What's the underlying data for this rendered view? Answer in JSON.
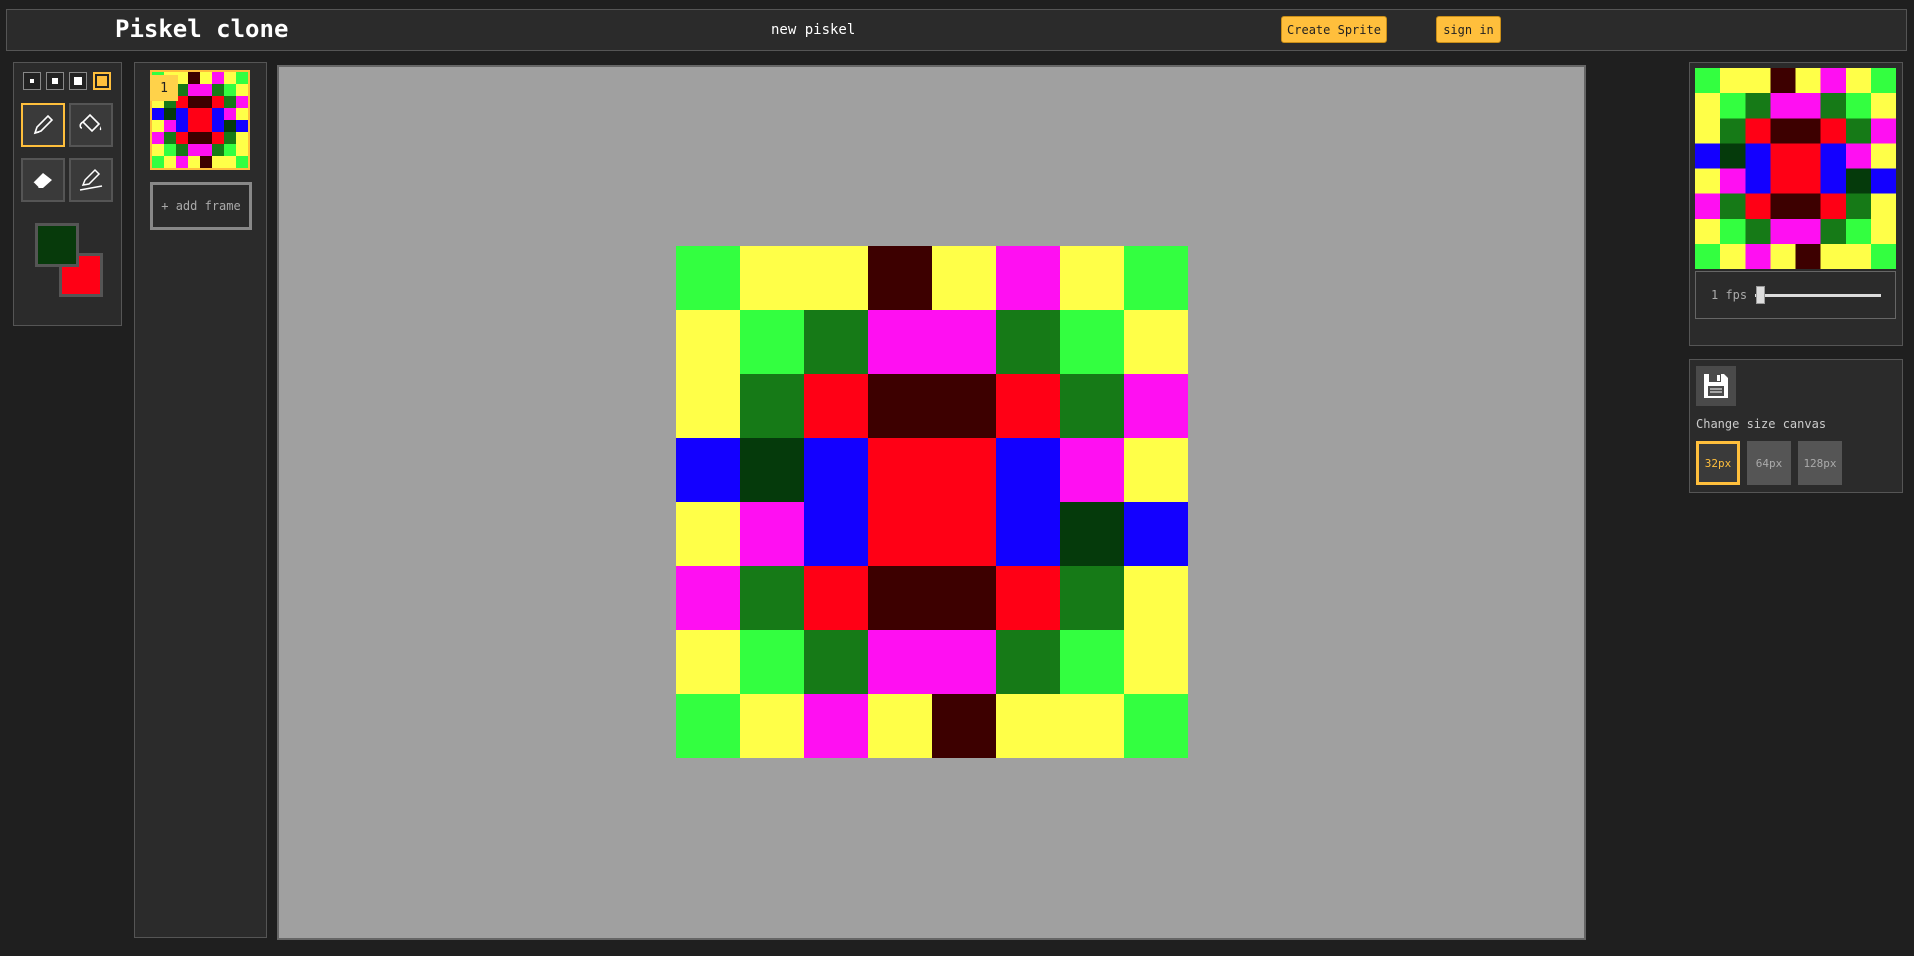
{
  "header": {
    "app_title": "Piskel clone",
    "doc_title": "new piskel",
    "create_label": "Create Sprite",
    "signin_label": "sign in"
  },
  "tools": {
    "pen_sizes": [
      1,
      2,
      3,
      4
    ],
    "selected_pen_size": 4,
    "items": [
      {
        "name": "pen",
        "icon": "pen-icon",
        "selected": true
      },
      {
        "name": "paint-bucket",
        "icon": "paint-bucket-icon",
        "selected": false
      },
      {
        "name": "eraser",
        "icon": "eraser-icon",
        "selected": false
      },
      {
        "name": "stroke",
        "icon": "stroke-icon",
        "selected": false
      }
    ],
    "primary_color": "#073a0b",
    "secondary_color": "#ff0015"
  },
  "frames": {
    "items": [
      {
        "number": "1"
      }
    ],
    "add_label": "+ add frame"
  },
  "palette": {
    "G": "#33ff40",
    "Y": "#ffff48",
    "K": "#3d0000",
    "M": "#ff0ff2",
    "D": "#167a17",
    "R": "#ff0015",
    "B": "#1300ff",
    "N": "#053a0b"
  },
  "sprite": [
    "GYYKYMYG",
    "YGDMMDGY",
    "YDRKKRDM",
    "BNBRRBMY",
    "YMBRRBNB",
    "MDRKKRDY",
    "YGDMMDGY",
    "GYMYKYYG"
  ],
  "preview": {
    "fps": 1,
    "fps_label": "1 fps"
  },
  "settings": {
    "change_size_label": "Change size canvas",
    "sizes": [
      "32px",
      "64px",
      "128px"
    ],
    "selected_size": "32px"
  }
}
